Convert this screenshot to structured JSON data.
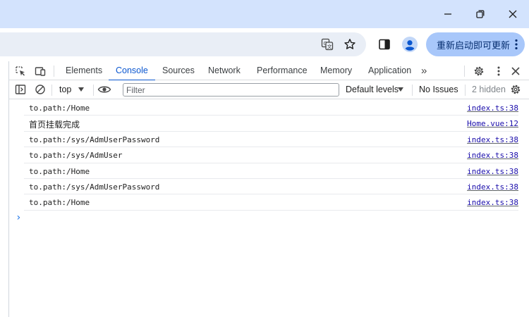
{
  "browser": {
    "update_label": "重新启动即可更新"
  },
  "devtools": {
    "tabs": [
      {
        "label": "Elements",
        "active": false
      },
      {
        "label": "Console",
        "active": true
      },
      {
        "label": "Sources",
        "active": false
      },
      {
        "label": "Network",
        "active": false
      },
      {
        "label": "Performance",
        "active": false
      },
      {
        "label": "Memory",
        "active": false
      },
      {
        "label": "Application",
        "active": false
      }
    ],
    "more_tabs_glyph": "»",
    "filterbar": {
      "context": "top",
      "filter_placeholder": "Filter",
      "filter_value": "",
      "levels": "Default levels",
      "issues": "No Issues",
      "hidden": "2 hidden"
    }
  },
  "console": {
    "messages": [
      {
        "text": "to.path:/Home",
        "source": "index.ts:38"
      },
      {
        "text": "首页挂载完成",
        "source": "Home.vue:12"
      },
      {
        "text": "to.path:/sys/AdmUserPassword",
        "source": "index.ts:38"
      },
      {
        "text": "to.path:/sys/AdmUser",
        "source": "index.ts:38"
      },
      {
        "text": "to.path:/Home",
        "source": "index.ts:38"
      },
      {
        "text": "to.path:/sys/AdmUserPassword",
        "source": "index.ts:38"
      },
      {
        "text": "to.path:/Home",
        "source": "index.ts:38"
      }
    ],
    "prompt_glyph": "›"
  },
  "icons": {
    "minimize": "minimize-icon",
    "restore": "restore-icon",
    "close": "close-icon",
    "translate": "translate-icon",
    "bookmark": "star-icon",
    "side_panel": "side-panel-icon",
    "profile": "profile-icon"
  },
  "colors": {
    "titlebar": "#d3e3fd",
    "omnibox": "#e9eef6",
    "update_button": "#a8c7fa",
    "active_tab": "#0b57d0",
    "link": "#1a0dab",
    "profile": "#0b57d0"
  }
}
